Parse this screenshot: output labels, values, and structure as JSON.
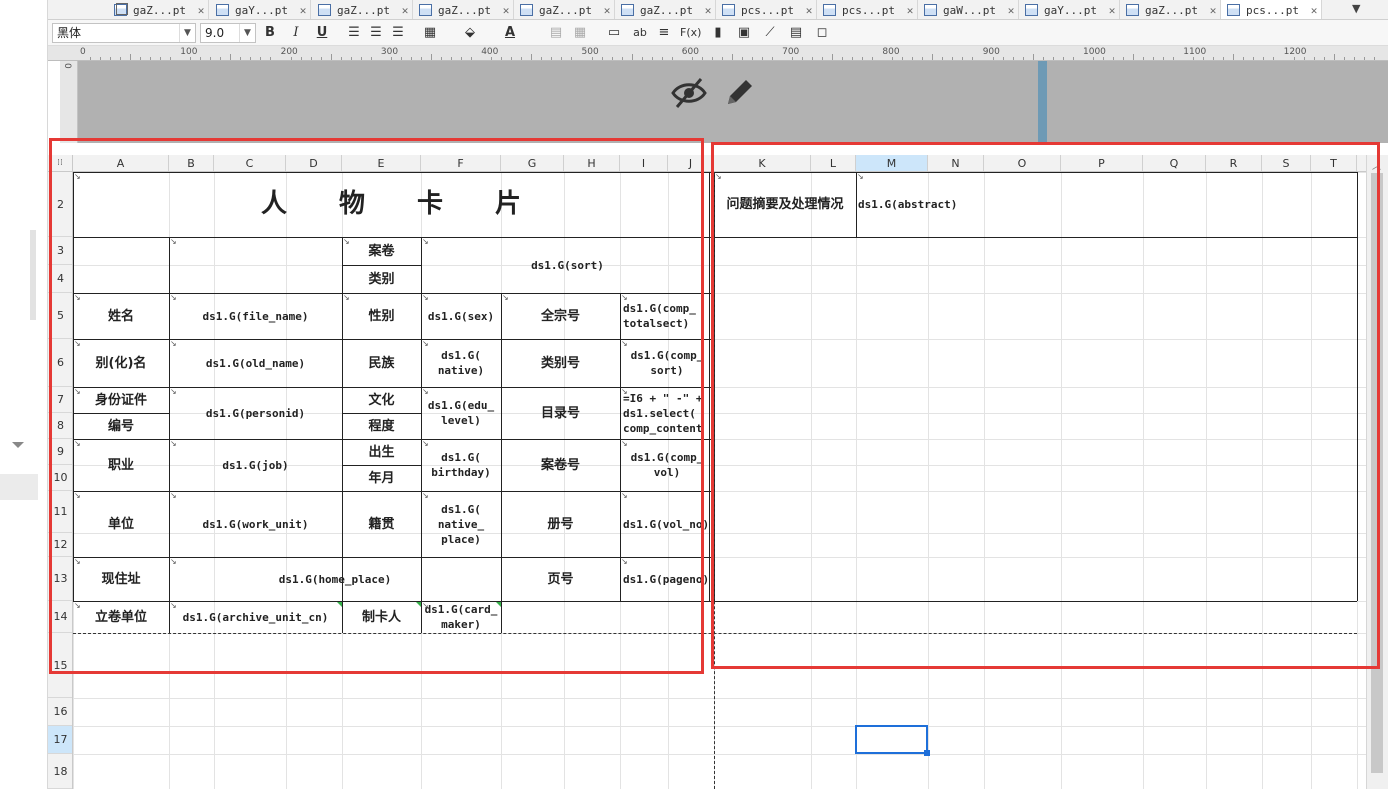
{
  "tabs": [
    {
      "label": "gaZ...pt"
    },
    {
      "label": "gaY...pt"
    },
    {
      "label": "gaZ...pt"
    },
    {
      "label": "gaZ...pt"
    },
    {
      "label": "gaZ...pt"
    },
    {
      "label": "gaZ...pt"
    },
    {
      "label": "pcs...pt"
    },
    {
      "label": "pcs...pt"
    },
    {
      "label": "gaW...pt"
    },
    {
      "label": "gaY...pt"
    },
    {
      "label": "gaZ...pt"
    },
    {
      "label": "pcs...pt"
    }
  ],
  "toolbar": {
    "font": "黑体",
    "size": "9.0",
    "bold": "B",
    "italic": "I",
    "underline": "U"
  },
  "ruler": [
    "0",
    "100",
    "200",
    "300",
    "400",
    "500",
    "600",
    "700",
    "800",
    "900",
    "1000",
    "1100",
    "1200"
  ],
  "columns": [
    "A",
    "B",
    "C",
    "D",
    "E",
    "F",
    "G",
    "H",
    "I",
    "J",
    "K",
    "L",
    "M",
    "N",
    "O",
    "P",
    "Q",
    "R",
    "S",
    "T"
  ],
  "rows": [
    "2",
    "3",
    "4",
    "5",
    "6",
    "7",
    "8",
    "9",
    "10",
    "11",
    "12",
    "13",
    "14",
    "15",
    "16",
    "17",
    "18"
  ],
  "vruler": "0",
  "card": {
    "title": "人　　物　　卡　　片",
    "anjuan": "案卷",
    "leibie": "类别",
    "sort": "ds1.G(sort)",
    "xingming": "姓名",
    "file_name": "ds1.G(file_name)",
    "xingbie": "性别",
    "sex": "ds1.G(sex)",
    "quanzonghao": "全宗号",
    "comp_total": "ds1.G(comp_\ntotalsect)",
    "biehua": "别(化)名",
    "old_name": "ds1.G(old_name)",
    "minzu": "民族",
    "native": "ds1.G(\nnative)",
    "leibiehao": "类别号",
    "comp_sort": "ds1.G(comp_\nsort)",
    "shenfen": "身份证件",
    "bianhao": "编号",
    "personid": "ds1.G(personid)",
    "wenhua": "文化",
    "chengdu": "程度",
    "edu": "ds1.G(edu_\nlevel)",
    "mululhao": "目录号",
    "formula": "=I6 + \" -\" +\nds1.select(\ncomp_content",
    "zhiye": "职业",
    "job": "ds1.G(job)",
    "chusheng": "出生",
    "nianyue": "年月",
    "birthday": "ds1.G(\nbirthday)",
    "anjuanhao": "案卷号",
    "comp_vol": "ds1.G(comp_\nvol)",
    "danwei": "单位",
    "work_unit": "ds1.G(work_unit)",
    "jiguan": "籍贯",
    "native_place": "ds1.G(\nnative_\nplace)",
    "ceh": "册号",
    "vol_no": "ds1.G(vol_no)",
    "xianzhuzhi": "现住址",
    "home_place": "ds1.G(home_place)",
    "yehao": "页号",
    "pageno": "ds1.G(pageno)",
    "lijuan": "立卷单位",
    "archive": "ds1.G(archive_unit_cn)",
    "zhika": "制卡人",
    "card_maker": "ds1.G(card_\nmaker)",
    "wenti": "问题摘要及处理情况",
    "abstract": "ds1.G(abstract)"
  }
}
